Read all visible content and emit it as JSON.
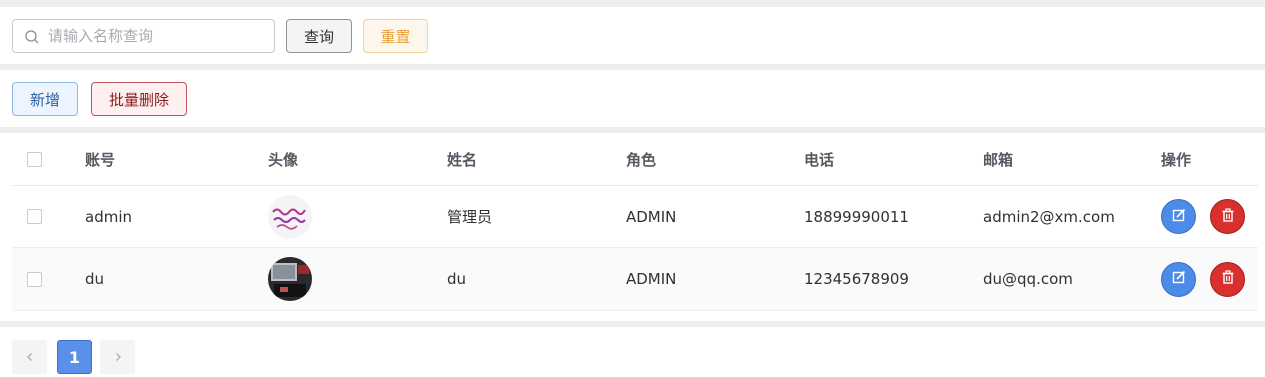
{
  "search": {
    "placeholder": "请输入名称查询",
    "value": ""
  },
  "toolbar": {
    "query_label": "查询",
    "reset_label": "重置"
  },
  "actions": {
    "add_label": "新增",
    "batch_delete_label": "批量删除"
  },
  "table": {
    "columns": [
      "账号",
      "头像",
      "姓名",
      "角色",
      "电话",
      "邮箱",
      "操作"
    ],
    "rows": [
      {
        "account": "admin",
        "avatar": "handwritten-text-avatar",
        "name": "管理员",
        "role": "ADMIN",
        "phone": "18899990011",
        "email": "admin2@xm.com"
      },
      {
        "account": "du",
        "avatar": "photo-avatar",
        "name": "du",
        "role": "ADMIN",
        "phone": "12345678909",
        "email": "du@qq.com"
      }
    ]
  },
  "pagination": {
    "current": "1"
  },
  "icons": [
    "search-icon",
    "edit-icon",
    "delete-icon",
    "chevron-left-icon",
    "chevron-right-icon"
  ],
  "colors": {
    "primary": "#5b8fe9",
    "danger": "#d9302f",
    "warning": "#e6a23c"
  }
}
